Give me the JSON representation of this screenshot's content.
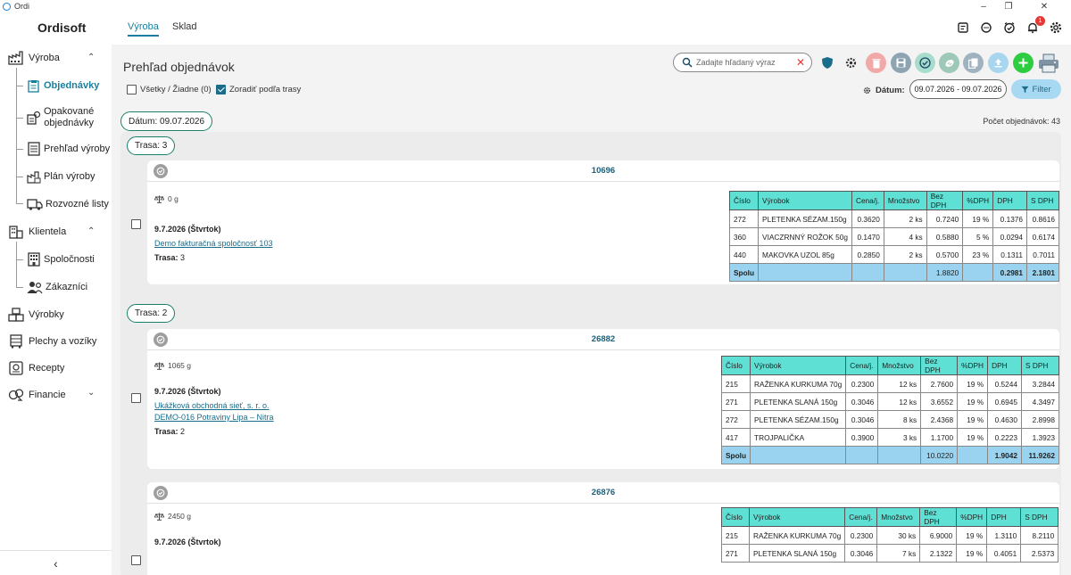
{
  "window": {
    "title": "Ordi"
  },
  "header": {
    "brand": "Ordisoft",
    "tabs": [
      "Výroba",
      "Sklad"
    ],
    "notification_count": "1"
  },
  "sidebar": {
    "vyroba": "Výroba",
    "objednavky": "Objednávky",
    "opakovane_1": "Opakované",
    "opakovane_2": "objednávky",
    "prehlad_vyroby": "Prehľad výroby",
    "plan_vyroby": "Plán výroby",
    "rozvozne_listy": "Rozvozné listy",
    "klientela": "Klientela",
    "spolocnosti": "Spoločnosti",
    "zakaznici": "Zákazníci",
    "vyrobky": "Výrobky",
    "plechy": "Plechy a vozíky",
    "recepty": "Recepty",
    "financie": "Financie"
  },
  "main": {
    "title": "Prehľad objednávok",
    "opt_all": "Všetky / Žiadne (0)",
    "opt_sort": "Zoradiť podľa trasy",
    "search_placeholder": "Zadajte hľadaný výraz",
    "date_label": "Dátum:",
    "date_range": "09.07.2026 - 09.07.2026",
    "filter_label": "Filter",
    "date_group": "Dátum: 09.07.2026",
    "order_count": "Počet objednávok: 43"
  },
  "headers": [
    "Číslo",
    "Výrobok",
    "Cena/j.",
    "Množstvo",
    "Bez DPH",
    "%DPH",
    "DPH",
    "S DPH"
  ],
  "sum_label": "Spolu",
  "routes": [
    "Trasa: 3",
    "Trasa: 2"
  ],
  "orders": [
    {
      "number": "10696",
      "weight": "0 g",
      "date": "9.7.2026 (Štvrtok)",
      "link1": "Demo fakturačná spoločnosť 103",
      "link2": "",
      "route_label": "Trasa:",
      "route_value": "3",
      "items": [
        [
          "272",
          "PLETENKA SÉZAM.150g",
          "0.3620",
          "2 ks",
          "0.7240",
          "19 %",
          "0.1376",
          "0.8616"
        ],
        [
          "360",
          "VIACZRNNÝ ROŽOK 50g",
          "0.1470",
          "4 ks",
          "0.5880",
          "5 %",
          "0.0294",
          "0.6174"
        ],
        [
          "440",
          "MAKOVKA UZOL 85g",
          "0.2850",
          "2 ks",
          "0.5700",
          "23 %",
          "0.1311",
          "0.7011"
        ]
      ],
      "sum": [
        "1.8820",
        "0.2981",
        "2.1801"
      ]
    },
    {
      "number": "26882",
      "weight": "1065 g",
      "date": "9.7.2026 (Štvrtok)",
      "link1": "Ukážková obchodná sieť, s. r. o.",
      "link2": "DEMO-016 Potraviny Lipa – Nitra",
      "route_label": "Trasa:",
      "route_value": "2",
      "items": [
        [
          "215",
          "RAŽENKA KURKUMA 70g",
          "0.2300",
          "12 ks",
          "2.7600",
          "19 %",
          "0.5244",
          "3.2844"
        ],
        [
          "271",
          "PLETENKA SLANÁ 150g",
          "0.3046",
          "12 ks",
          "3.6552",
          "19 %",
          "0.6945",
          "4.3497"
        ],
        [
          "272",
          "PLETENKA SÉZAM.150g",
          "0.3046",
          "8 ks",
          "2.4368",
          "19 %",
          "0.4630",
          "2.8998"
        ],
        [
          "417",
          "TROJPALIČKA",
          "0.3900",
          "3 ks",
          "1.1700",
          "19 %",
          "0.2223",
          "1.3923"
        ]
      ],
      "sum": [
        "10.0220",
        "1.9042",
        "11.9262"
      ]
    },
    {
      "number": "26876",
      "weight": "2450 g",
      "date": "9.7.2026 (Štvrtok)",
      "items": [
        [
          "215",
          "RAŽENKA KURKUMA 70g",
          "0.2300",
          "30 ks",
          "6.9000",
          "19 %",
          "1.3110",
          "8.2110"
        ],
        [
          "271",
          "PLETENKA SLANÁ 150g",
          "0.3046",
          "7 ks",
          "2.1322",
          "19 %",
          "0.4051",
          "2.5373"
        ]
      ]
    }
  ]
}
